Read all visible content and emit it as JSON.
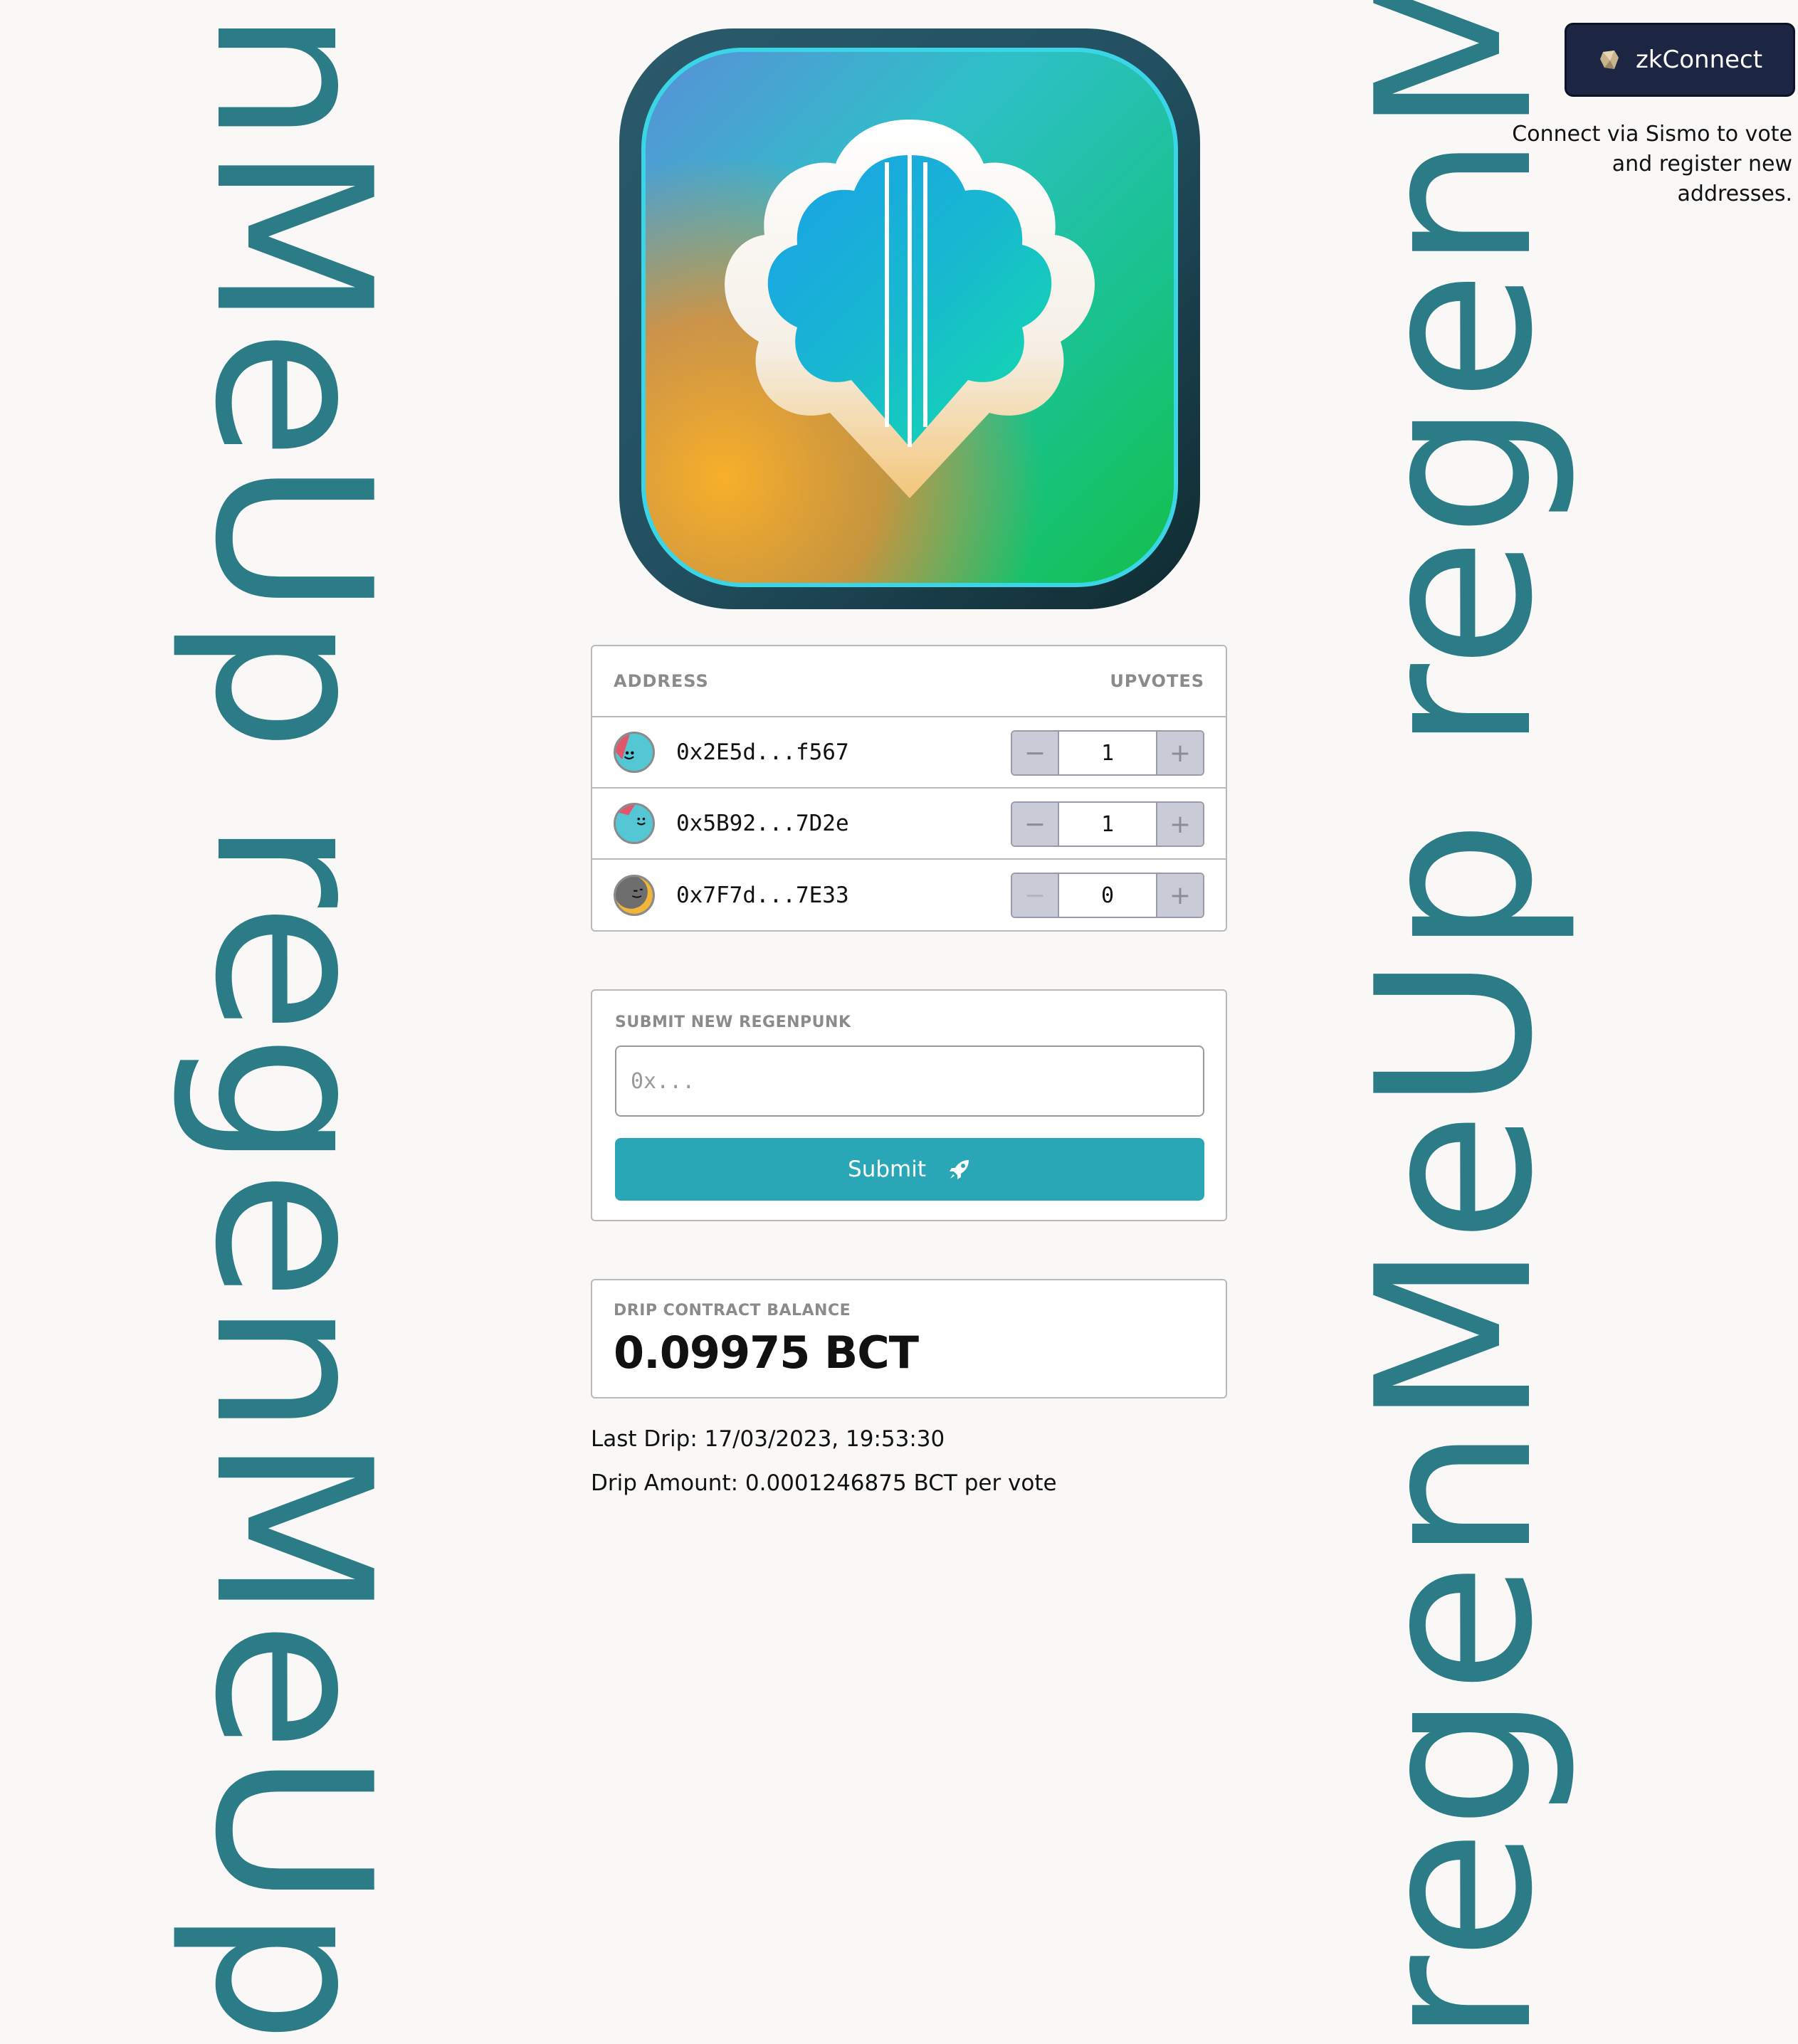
{
  "background": {
    "repeated_text": "regenMeUp regenMeUp",
    "color": "#2b7c86"
  },
  "header": {
    "connect_button_label": "zkConnect",
    "connect_help": "Connect via Sismo to vote and register new addresses."
  },
  "votes_table": {
    "col_address": "ADDRESS",
    "col_upvotes": "UPVOTES",
    "rows": [
      {
        "address": "0x2E5d...f567",
        "upvotes": "1",
        "minus": "−",
        "plus": "+"
      },
      {
        "address": "0x5B92...7D2e",
        "upvotes": "1",
        "minus": "−",
        "plus": "+"
      },
      {
        "address": "0x7F7d...7E33",
        "upvotes": "0",
        "minus": "−",
        "plus": "+"
      }
    ]
  },
  "submit_form": {
    "label": "SUBMIT NEW REGENPUNK",
    "placeholder": "0x...",
    "value": "",
    "button_label": "Submit"
  },
  "drip": {
    "balance_label": "DRIP CONTRACT BALANCE",
    "balance_value": "0.09975 BCT",
    "last_drip": "Last Drip: 17/03/2023, 19:53:30",
    "drip_amount": "Drip Amount: 0.0001246875 BCT per vote"
  },
  "colors": {
    "accent": "#2aa7b6",
    "connect_bg": "#1c2643",
    "page_bg": "#f9f8f7"
  },
  "icons": {
    "logo": "regenmeup-app-logo",
    "connect": "sismo-logo-icon",
    "submit": "rocket-icon"
  }
}
